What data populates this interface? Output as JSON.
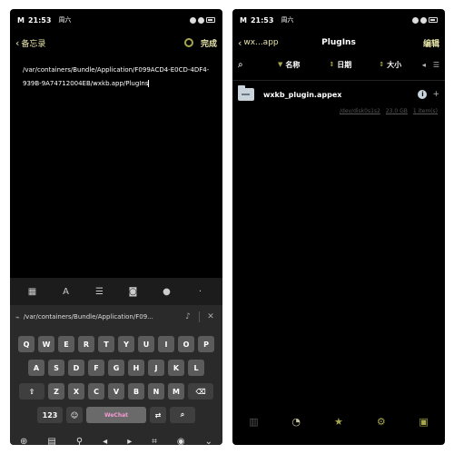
{
  "left": {
    "status": {
      "brand": "M",
      "time": "21:53",
      "day": "周六"
    },
    "header": {
      "back_label": "备忘录",
      "done_label": "完成"
    },
    "note_text": "/var/containers/Bundle/Application/F099ACD4-E0CD-4DF4-939B-9A74712004EB/wxkb.app/PlugIns",
    "suggestion": "/var/containers/Bundle/Application/F09...",
    "keyboard": {
      "row1": [
        "Q",
        "W",
        "E",
        "R",
        "T",
        "Y",
        "U",
        "I",
        "O",
        "P"
      ],
      "row2": [
        "A",
        "S",
        "D",
        "F",
        "G",
        "H",
        "J",
        "K",
        "L"
      ],
      "row3": [
        "Z",
        "X",
        "C",
        "V",
        "B",
        "N",
        "M"
      ],
      "numbers_label": "123",
      "space_label": "WeChat"
    }
  },
  "right": {
    "status": {
      "brand": "M",
      "time": "21:53",
      "day": "周六"
    },
    "header": {
      "back_label": "wx...app",
      "title": "PlugIns",
      "edit_label": "编辑"
    },
    "sort": {
      "name": "名称",
      "date": "日期",
      "size": "大小"
    },
    "files": [
      {
        "name": "wxkb_plugin.appex"
      }
    ],
    "disk": {
      "path": "/dev/disk0s1s2",
      "size": "23.0 GB",
      "count": "1 item(s)"
    }
  },
  "colors": {
    "accent": "#e6e3a8",
    "accent_dark": "#a7a64a"
  }
}
